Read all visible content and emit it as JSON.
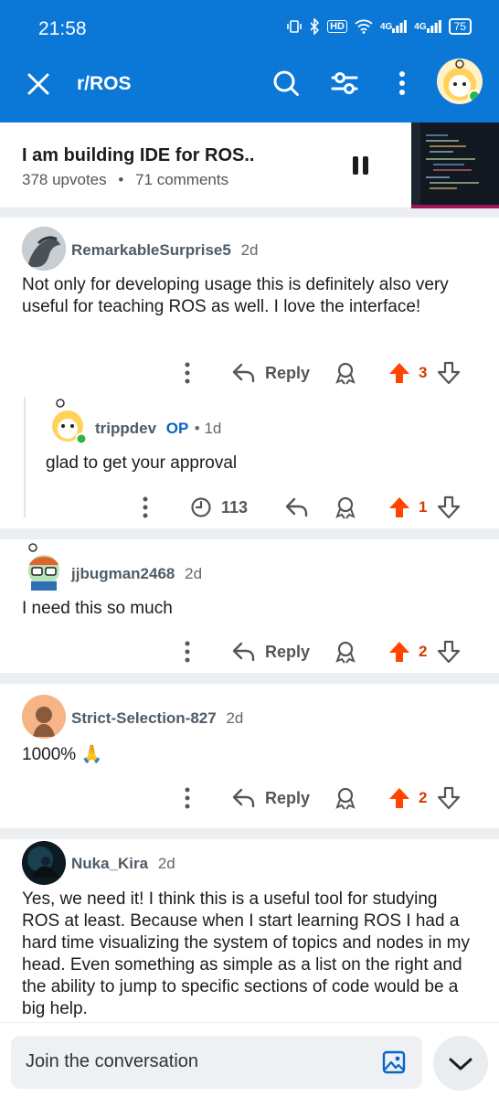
{
  "status": {
    "time": "21:58",
    "hd": "HD",
    "net1": "4G",
    "net2": "4G",
    "battery": "75"
  },
  "header": {
    "title": "r/ROS",
    "close_icon": "close-icon",
    "search_icon": "search-icon",
    "filter_icon": "filter-icon",
    "more_icon": "more-vertical-icon",
    "brand_color": "#0b78d7"
  },
  "post": {
    "title": "I am building IDE for ROS..",
    "upvotes": "378 upvotes",
    "separator": "•",
    "comments": "71 comments"
  },
  "comments": [
    {
      "user": "RemarkableSurprise5",
      "time": "2d",
      "text": "Not only for developing usage this is definitely also very useful for teaching ROS as well. I love the interface!",
      "reply_label": "Reply",
      "votes": "3"
    },
    {
      "user": "trippdev",
      "op": "OP",
      "time": "• 1d",
      "text": "glad to get your approval",
      "views": "113",
      "votes": "1"
    },
    {
      "user": "jjbugman2468",
      "time": "2d",
      "text": "I need this so much",
      "reply_label": "Reply",
      "votes": "2"
    },
    {
      "user": "Strict-Selection-827",
      "time": "2d",
      "text": "1000% 🙏",
      "reply_label": "Reply",
      "votes": "2"
    },
    {
      "user": "Nuka_Kira",
      "time": "2d",
      "text": "Yes, we need it! I think this is a useful tool for studying ROS at least. Because when I start learning ROS I had a hard time visualizing the system of topics and nodes in my head. Even something as simple as a list on the right and the ability to jump to specific sections of code would be a big help."
    }
  ],
  "composer": {
    "placeholder": "Join the conversation"
  },
  "colors": {
    "upvote": "#ff4500",
    "op": "#0b63c5"
  }
}
